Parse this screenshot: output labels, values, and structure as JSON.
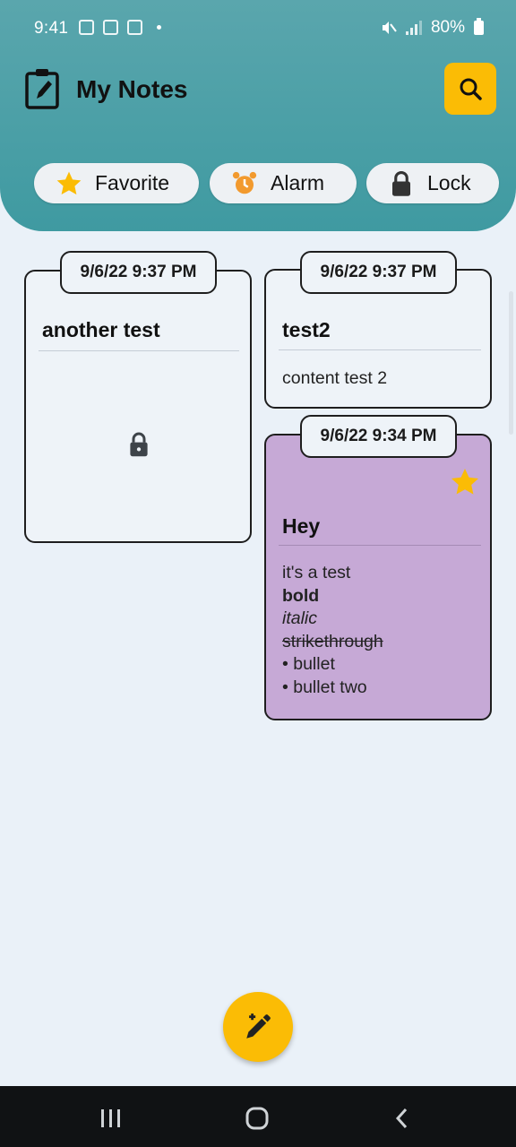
{
  "status_bar": {
    "time": "9:41",
    "battery": "80%"
  },
  "header": {
    "title": "My Notes",
    "search_icon": "search-icon",
    "app_icon": "notepad-icon"
  },
  "filters": [
    {
      "label": "Favorite",
      "icon": "star-icon"
    },
    {
      "label": "Alarm",
      "icon": "alarm-clock-icon"
    },
    {
      "label": "Lock",
      "icon": "lock-icon"
    }
  ],
  "notes": [
    {
      "date": "9/6/22 9:37 PM",
      "title": "another test",
      "locked": true,
      "favorite": false
    },
    {
      "date": "9/6/22 9:37 PM",
      "title": "test2",
      "content": "content test 2",
      "locked": false,
      "favorite": false
    },
    {
      "date": "9/6/22 9:34 PM",
      "title": "Hey",
      "favorite": true,
      "locked": false,
      "color": "#c6a9d6",
      "content_lines": [
        "it's a test",
        "bold",
        "italic",
        "strikethrough",
        "• bullet",
        "• bullet two"
      ]
    }
  ],
  "fab": {
    "icon": "new-note-pencil-icon"
  },
  "colors": {
    "header": "#4a9fa6",
    "accent": "#fbbc05",
    "background": "#eaf1f8",
    "favorite_card": "#c6a9d6"
  }
}
